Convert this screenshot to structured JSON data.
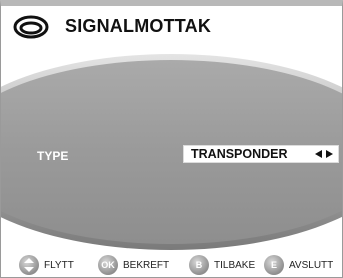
{
  "header": {
    "title": "SIGNALMOTTAK",
    "logo_icon": "signal-satellite-logo-icon"
  },
  "menu": {
    "type_label": "TYPE",
    "type_value": "TRANSPONDER",
    "value_arrows_icon": "left-right-arrows-icon"
  },
  "footer": {
    "move": {
      "icon": "up-down-arrows-icon",
      "label": "FLYTT"
    },
    "confirm": {
      "badge": "OK",
      "label": "BEKREFT"
    },
    "back": {
      "badge": "B",
      "label": "TILBAKE"
    },
    "exit": {
      "badge": "E",
      "label": "AVSLUTT"
    }
  },
  "colors": {
    "panel_gray": "#9c9c9c",
    "button_gray": "#8f8f8f"
  }
}
